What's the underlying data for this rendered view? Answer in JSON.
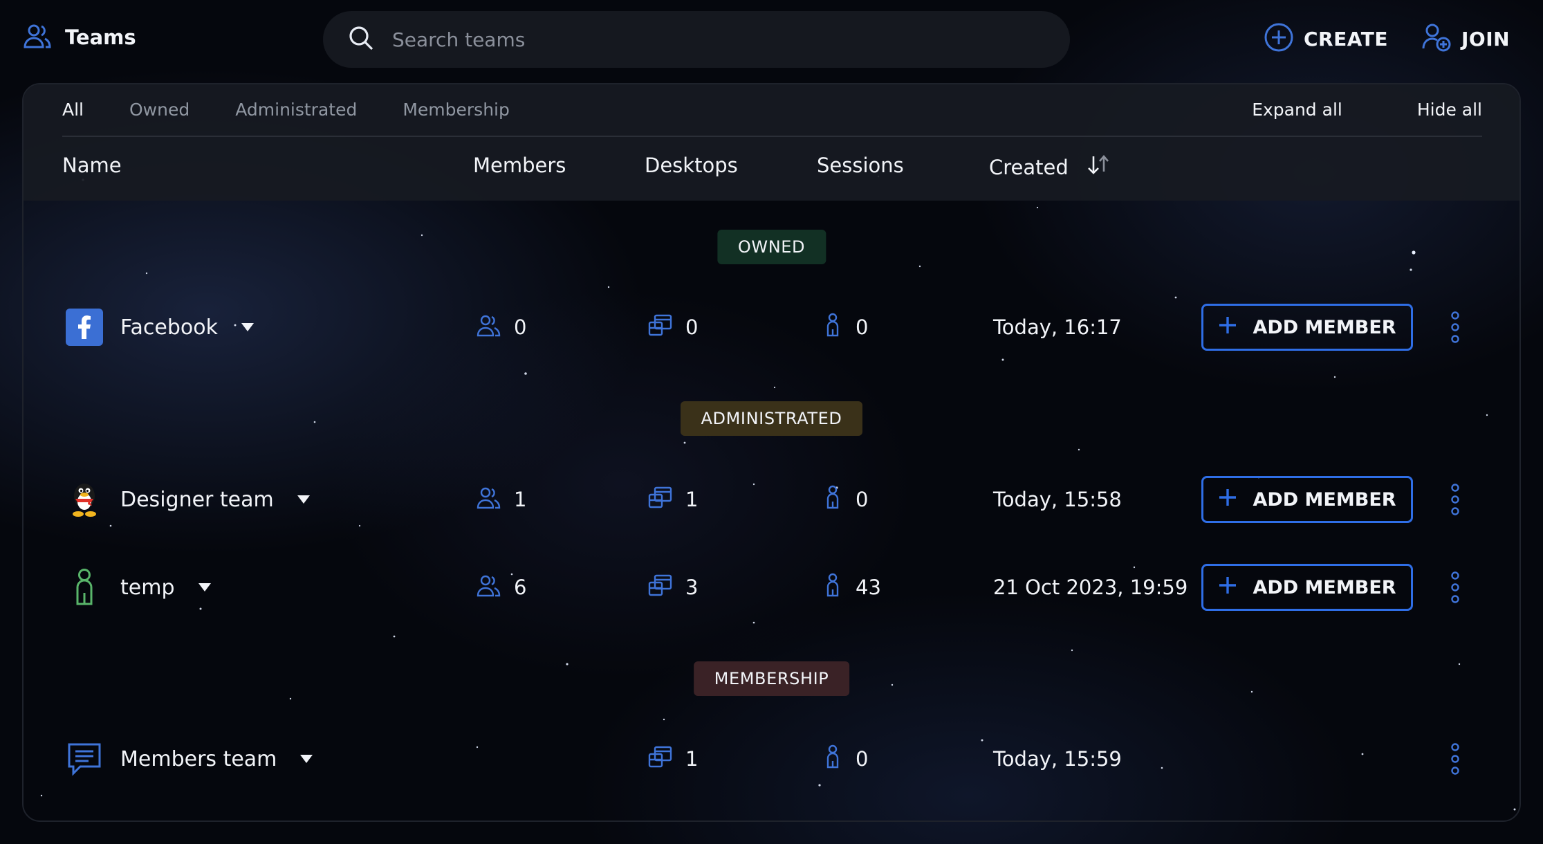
{
  "header": {
    "title": "Teams",
    "search_placeholder": "Search teams",
    "create_label": "CREATE",
    "join_label": "JOIN"
  },
  "tabs": [
    {
      "label": "All",
      "active": true
    },
    {
      "label": "Owned",
      "active": false
    },
    {
      "label": "Administrated",
      "active": false
    },
    {
      "label": "Membership",
      "active": false
    }
  ],
  "actions": {
    "expand_all": "Expand all",
    "hide_all": "Hide all"
  },
  "columns": {
    "name": "Name",
    "members": "Members",
    "desktops": "Desktops",
    "sessions": "Sessions",
    "created": "Created",
    "sort_icon": "sort-arrows-icon"
  },
  "add_member_label": "ADD MEMBER",
  "colors": {
    "accent": "#2f6ee6",
    "icon_blue": "#3f74d9",
    "owned_badge": "#123024",
    "administrated_badge": "#3a3119",
    "membership_badge": "#3a2226"
  },
  "sections": [
    {
      "label": "OWNED",
      "teams": [
        {
          "icon": "facebook-logo-icon",
          "name": "Facebook",
          "members": "0",
          "desktops": "0",
          "sessions": "0",
          "created": "Today, 16:17",
          "show_add": true,
          "show_members": true
        }
      ]
    },
    {
      "label": "ADMINISTRATED",
      "teams": [
        {
          "icon": "penguin-logo-icon",
          "name": "Designer team",
          "members": "1",
          "desktops": "1",
          "sessions": "0",
          "created": "Today, 15:58",
          "show_add": true,
          "show_members": true
        },
        {
          "icon": "person-outline-icon",
          "name": "temp",
          "members": "6",
          "desktops": "3",
          "sessions": "43",
          "created": "21 Oct 2023, 19:59",
          "show_add": true,
          "show_members": true
        }
      ]
    },
    {
      "label": "MEMBERSHIP",
      "teams": [
        {
          "icon": "chat-bubble-icon",
          "name": "Members team",
          "members": "",
          "desktops": "1",
          "sessions": "0",
          "created": "Today, 15:59",
          "show_add": false,
          "show_members": false
        }
      ]
    }
  ]
}
